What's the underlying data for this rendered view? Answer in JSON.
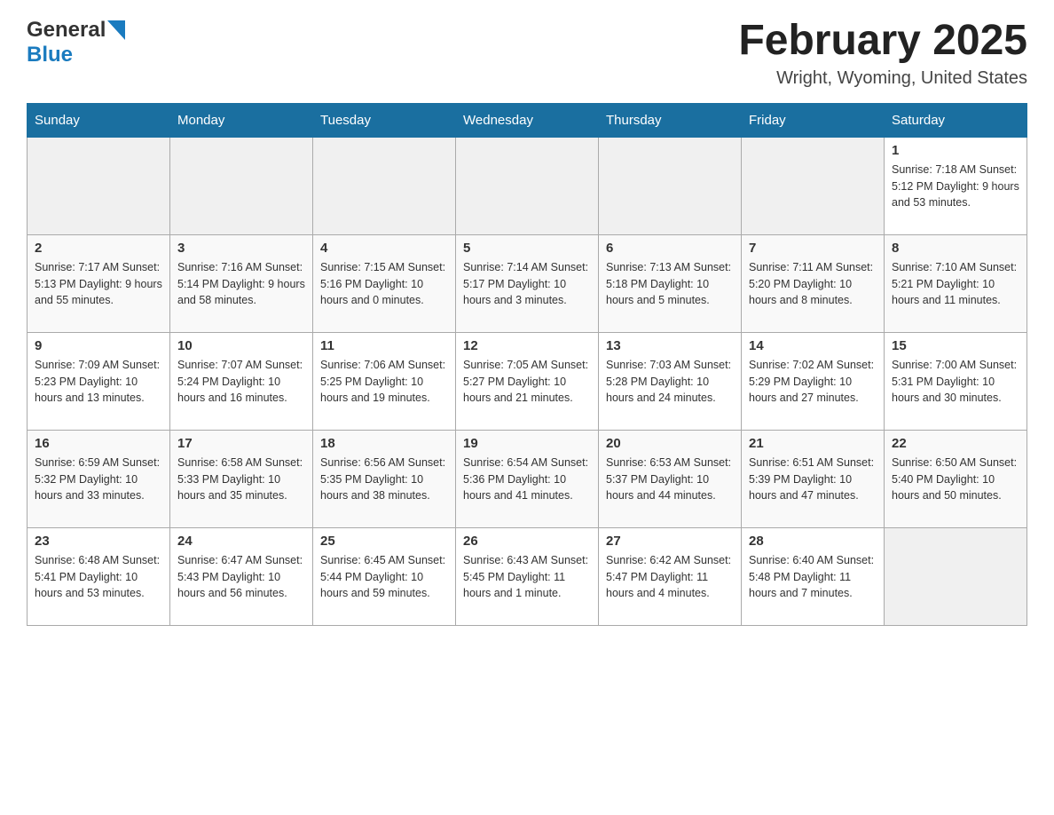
{
  "header": {
    "logo_general": "General",
    "logo_blue": "Blue",
    "title": "February 2025",
    "subtitle": "Wright, Wyoming, United States"
  },
  "days_of_week": [
    "Sunday",
    "Monday",
    "Tuesday",
    "Wednesday",
    "Thursday",
    "Friday",
    "Saturday"
  ],
  "weeks": [
    [
      {
        "num": "",
        "info": ""
      },
      {
        "num": "",
        "info": ""
      },
      {
        "num": "",
        "info": ""
      },
      {
        "num": "",
        "info": ""
      },
      {
        "num": "",
        "info": ""
      },
      {
        "num": "",
        "info": ""
      },
      {
        "num": "1",
        "info": "Sunrise: 7:18 AM\nSunset: 5:12 PM\nDaylight: 9 hours\nand 53 minutes."
      }
    ],
    [
      {
        "num": "2",
        "info": "Sunrise: 7:17 AM\nSunset: 5:13 PM\nDaylight: 9 hours\nand 55 minutes."
      },
      {
        "num": "3",
        "info": "Sunrise: 7:16 AM\nSunset: 5:14 PM\nDaylight: 9 hours\nand 58 minutes."
      },
      {
        "num": "4",
        "info": "Sunrise: 7:15 AM\nSunset: 5:16 PM\nDaylight: 10 hours\nand 0 minutes."
      },
      {
        "num": "5",
        "info": "Sunrise: 7:14 AM\nSunset: 5:17 PM\nDaylight: 10 hours\nand 3 minutes."
      },
      {
        "num": "6",
        "info": "Sunrise: 7:13 AM\nSunset: 5:18 PM\nDaylight: 10 hours\nand 5 minutes."
      },
      {
        "num": "7",
        "info": "Sunrise: 7:11 AM\nSunset: 5:20 PM\nDaylight: 10 hours\nand 8 minutes."
      },
      {
        "num": "8",
        "info": "Sunrise: 7:10 AM\nSunset: 5:21 PM\nDaylight: 10 hours\nand 11 minutes."
      }
    ],
    [
      {
        "num": "9",
        "info": "Sunrise: 7:09 AM\nSunset: 5:23 PM\nDaylight: 10 hours\nand 13 minutes."
      },
      {
        "num": "10",
        "info": "Sunrise: 7:07 AM\nSunset: 5:24 PM\nDaylight: 10 hours\nand 16 minutes."
      },
      {
        "num": "11",
        "info": "Sunrise: 7:06 AM\nSunset: 5:25 PM\nDaylight: 10 hours\nand 19 minutes."
      },
      {
        "num": "12",
        "info": "Sunrise: 7:05 AM\nSunset: 5:27 PM\nDaylight: 10 hours\nand 21 minutes."
      },
      {
        "num": "13",
        "info": "Sunrise: 7:03 AM\nSunset: 5:28 PM\nDaylight: 10 hours\nand 24 minutes."
      },
      {
        "num": "14",
        "info": "Sunrise: 7:02 AM\nSunset: 5:29 PM\nDaylight: 10 hours\nand 27 minutes."
      },
      {
        "num": "15",
        "info": "Sunrise: 7:00 AM\nSunset: 5:31 PM\nDaylight: 10 hours\nand 30 minutes."
      }
    ],
    [
      {
        "num": "16",
        "info": "Sunrise: 6:59 AM\nSunset: 5:32 PM\nDaylight: 10 hours\nand 33 minutes."
      },
      {
        "num": "17",
        "info": "Sunrise: 6:58 AM\nSunset: 5:33 PM\nDaylight: 10 hours\nand 35 minutes."
      },
      {
        "num": "18",
        "info": "Sunrise: 6:56 AM\nSunset: 5:35 PM\nDaylight: 10 hours\nand 38 minutes."
      },
      {
        "num": "19",
        "info": "Sunrise: 6:54 AM\nSunset: 5:36 PM\nDaylight: 10 hours\nand 41 minutes."
      },
      {
        "num": "20",
        "info": "Sunrise: 6:53 AM\nSunset: 5:37 PM\nDaylight: 10 hours\nand 44 minutes."
      },
      {
        "num": "21",
        "info": "Sunrise: 6:51 AM\nSunset: 5:39 PM\nDaylight: 10 hours\nand 47 minutes."
      },
      {
        "num": "22",
        "info": "Sunrise: 6:50 AM\nSunset: 5:40 PM\nDaylight: 10 hours\nand 50 minutes."
      }
    ],
    [
      {
        "num": "23",
        "info": "Sunrise: 6:48 AM\nSunset: 5:41 PM\nDaylight: 10 hours\nand 53 minutes."
      },
      {
        "num": "24",
        "info": "Sunrise: 6:47 AM\nSunset: 5:43 PM\nDaylight: 10 hours\nand 56 minutes."
      },
      {
        "num": "25",
        "info": "Sunrise: 6:45 AM\nSunset: 5:44 PM\nDaylight: 10 hours\nand 59 minutes."
      },
      {
        "num": "26",
        "info": "Sunrise: 6:43 AM\nSunset: 5:45 PM\nDaylight: 11 hours\nand 1 minute."
      },
      {
        "num": "27",
        "info": "Sunrise: 6:42 AM\nSunset: 5:47 PM\nDaylight: 11 hours\nand 4 minutes."
      },
      {
        "num": "28",
        "info": "Sunrise: 6:40 AM\nSunset: 5:48 PM\nDaylight: 11 hours\nand 7 minutes."
      },
      {
        "num": "",
        "info": ""
      }
    ]
  ]
}
